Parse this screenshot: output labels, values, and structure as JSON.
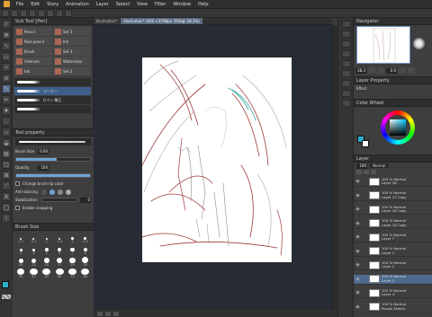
{
  "menu": [
    "File",
    "Edit",
    "Story",
    "Animation",
    "Layer",
    "Select",
    "View",
    "Filter",
    "Window",
    "Help"
  ],
  "tabs": [
    {
      "label": "Illustration*",
      "active": false
    },
    {
      "label": "Illustration* (600 x 8788px 350dpi 28.3%)",
      "active": true
    }
  ],
  "subtool": {
    "title": "Sub Tool [Pen]",
    "items": [
      {
        "label": "Pencil",
        "icon": "pencil-icon"
      },
      {
        "label": "Set 3",
        "icon": "set-icon"
      },
      {
        "label": "Real pencil",
        "icon": "pencil-icon"
      },
      {
        "label": "Ink",
        "icon": "ink-icon"
      },
      {
        "label": "Brush",
        "icon": "brush-icon"
      },
      {
        "label": "Set 3",
        "icon": "set-icon"
      },
      {
        "label": "Airbrush",
        "icon": "airbrush-icon"
      },
      {
        "label": "Watercolor",
        "icon": "watercolor-icon"
      },
      {
        "label": "Ink",
        "icon": "ink-icon"
      },
      {
        "label": "Set 2",
        "icon": "set-icon"
      }
    ],
    "brushes": [
      {
        "label": "",
        "selected": false
      },
      {
        "label": "マーカー",
        "selected": true
      },
      {
        "label": "Gペン 筆圧",
        "selected": false
      },
      {
        "label": "",
        "selected": false
      }
    ]
  },
  "toolprop": {
    "title": "Tool property",
    "brush_size_label": "Brush Size",
    "brush_size": "0.00",
    "brush_size_level": 0.55,
    "opacity_label": "Opacity",
    "opacity": "100",
    "opacity_level": 1.0,
    "change_color_label": "Change brush tip color",
    "antialias_label": "Anti-aliasing",
    "stabilization_label": "Stabilization",
    "stabilization": "0",
    "snapping_label": "Enable snapping"
  },
  "brushsize": {
    "title": "Brush Size",
    "sizes": [
      "0.7",
      "0.7",
      "1",
      "1.5",
      "2",
      "2.5",
      "3",
      "4",
      "5",
      "6",
      "7",
      "8",
      "10",
      "12",
      "15",
      "17",
      "20",
      "25",
      "30",
      "40",
      "50",
      "60",
      "70",
      "80"
    ]
  },
  "navigator": {
    "title": "Navigator",
    "zoom": "28.3",
    "angle": "0.0"
  },
  "layer_property": {
    "title": "Layer Property",
    "effect_label": "Effect"
  },
  "color_wheel": {
    "title": "Color Wheel",
    "main_color": "#2ab0c8",
    "sub_color": "#ffffff"
  },
  "layers": {
    "title": "Layer",
    "blend_mode": "Normal",
    "opacity": "100",
    "rows": [
      {
        "name": "Layer 18",
        "mode": "100 % Normal",
        "type": "raster",
        "selected": false
      },
      {
        "name": "Layer 17 Copy",
        "mode": "100 % Normal",
        "type": "raster",
        "selected": false
      },
      {
        "name": "Layer 16 Copy",
        "mode": "100 % Normal",
        "type": "raster",
        "selected": false
      },
      {
        "name": "Layer 16 Copy",
        "mode": "100 % Normal",
        "type": "raster",
        "selected": false
      },
      {
        "name": "Layer 7",
        "mode": "100 % Normal",
        "type": "raster",
        "selected": false
      },
      {
        "name": "Layer 1",
        "mode": "100 % Normal",
        "type": "raster",
        "selected": false
      },
      {
        "name": "Layer 2",
        "mode": "100 % Normal",
        "type": "raster",
        "selected": false
      },
      {
        "name": "Layer 3",
        "mode": "100 % Normal",
        "type": "raster",
        "selected": true
      },
      {
        "name": "Layer 4",
        "mode": "100 % Normal",
        "type": "raster",
        "selected": false
      },
      {
        "name": "Rough Sketch",
        "mode": "100 % Normal",
        "type": "raster",
        "selected": false
      }
    ]
  }
}
